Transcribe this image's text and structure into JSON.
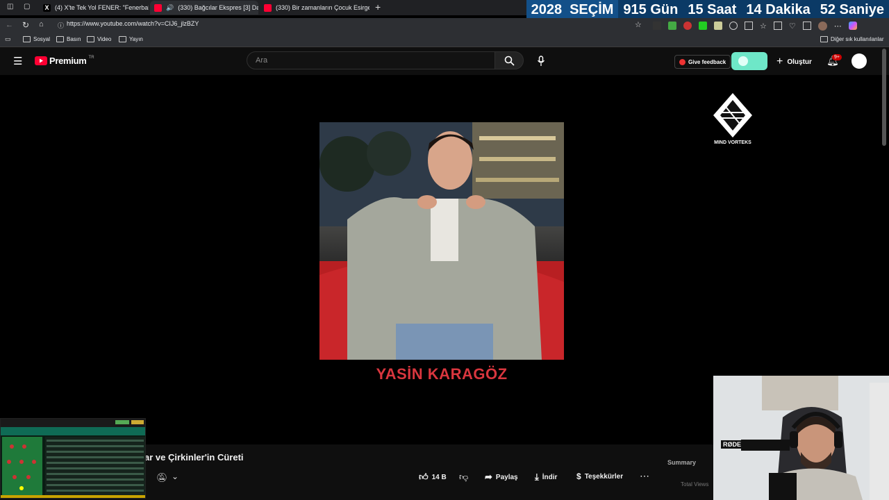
{
  "browser": {
    "tabs": [
      {
        "title": "(4) X'te Tek Yol FENER: \"Fenerbah",
        "favicon": "x-icon"
      },
      {
        "title": "(330) Bağcılar Ekspres [3] Da",
        "favicon": "youtube-icon"
      },
      {
        "title": "(330) Bir zamanların Çocuk Esirge",
        "favicon": "youtube-icon"
      }
    ],
    "url": "https://www.youtube.com/watch?v=CIJ6_jlzBZY",
    "bookmarks": [
      "Sosyal",
      "Basın",
      "Video",
      "Yayın"
    ],
    "other_bookmarks": "Diğer sık kullanılanlar"
  },
  "countdown": {
    "year": "2028",
    "label": "SEÇİM",
    "days": "915 Gün",
    "hours": "15 Saat",
    "minutes": "14 Dakika",
    "seconds": "52 Saniye"
  },
  "youtube": {
    "logo": "Premium",
    "region": "TR",
    "search_placeholder": "Ara",
    "feedback": "Give feedback",
    "create": "Oluştur",
    "notifications": "9+"
  },
  "video": {
    "person_name": "YASİN KARAGÖZ",
    "brand": "MIND VORTEKS",
    "title_visible": "ar ve Çirkinler'in Cüreti",
    "likes": "14 B",
    "share": "Paylaş",
    "download": "İndir",
    "thanks": "Teşekkürler",
    "summary": "Summary",
    "total_views": "Total Views"
  },
  "webcam": {
    "mic_label": "RØDE"
  },
  "colors": {
    "countdown_bg": "#0b3a66",
    "name_red": "#d9363e",
    "toggle_teal": "#6ee7c8",
    "yt_red": "#ff0033"
  }
}
